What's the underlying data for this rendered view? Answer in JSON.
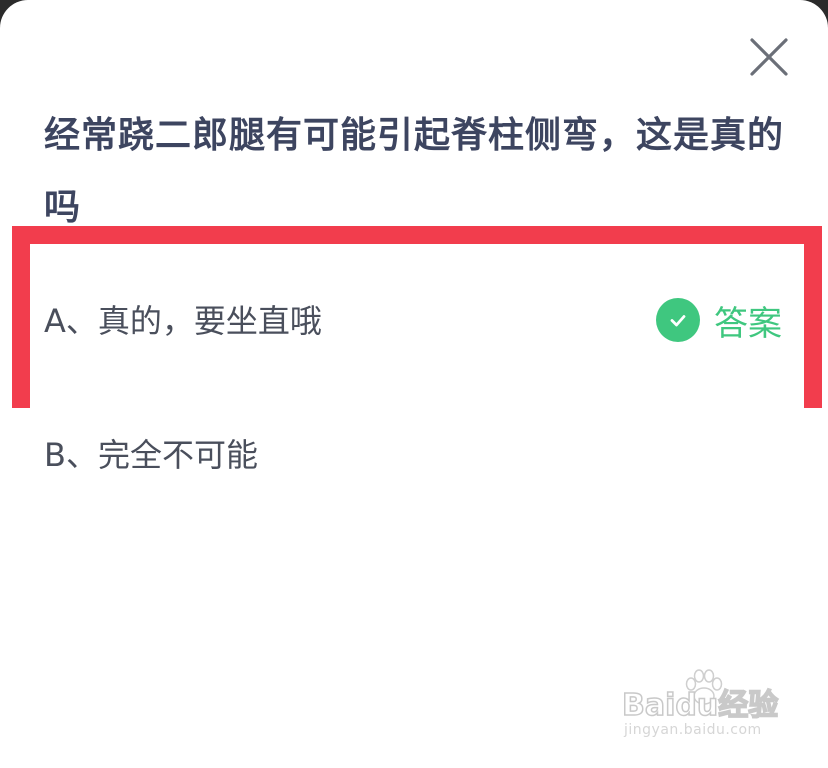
{
  "dialog": {
    "question": "经常跷二郎腿有可能引起脊柱侧弯，这是真的吗",
    "close_icon": "close-icon"
  },
  "options": [
    {
      "text": "A、真的，要坐直哦",
      "is_answer": true,
      "answer_label": "答案",
      "answer_icon": "check-circle-icon"
    },
    {
      "text": "B、完全不可能",
      "is_answer": false
    }
  ],
  "highlight": {
    "color": "#f23d4d",
    "target": "option-a"
  },
  "colors": {
    "question_text": "#3d4560",
    "option_text": "#4a4f5c",
    "answer_green": "#3fc77f"
  },
  "watermark": {
    "brand": "Baidu经验",
    "url": "jingyan.baidu.com"
  }
}
